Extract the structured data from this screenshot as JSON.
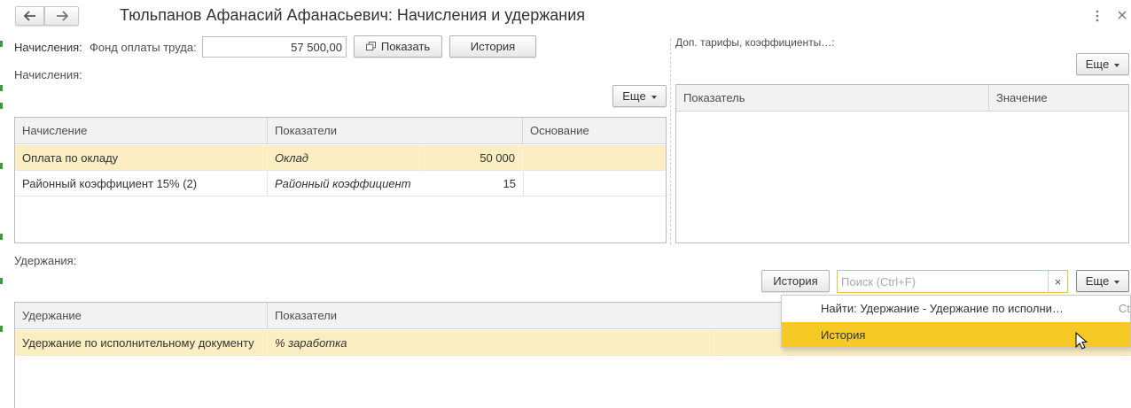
{
  "window": {
    "title": "Тюльпанов Афанасий Афанасьевич: Начисления и удержания",
    "more_icon": "more-vertical-icon",
    "close_icon": "close-icon",
    "back_icon": "arrow-left-icon",
    "forward_icon": "arrow-right-icon"
  },
  "accruals_bar": {
    "label": "Начисления:",
    "fund_label": "Фонд оплаты труда:",
    "fund_value": "57 500,00",
    "show_button": "Показать",
    "history_button": "История"
  },
  "accruals_section": {
    "label": "Начисления:",
    "more_button": "Еще",
    "columns": [
      "Начисление",
      "Показатели",
      "Основание"
    ],
    "rows": [
      {
        "name": "Оплата по окладу",
        "indicator": "Оклад",
        "value": "50 000",
        "basis": "",
        "selected": true
      },
      {
        "name": "Районный коэффициент 15% (2)",
        "indicator": "Районный коэффициент",
        "value": "15",
        "basis": "",
        "selected": false
      }
    ]
  },
  "tariffs_section": {
    "label": "Доп. тарифы, коэффициенты…:",
    "more_button": "Еще",
    "columns": [
      "Показатель",
      "Значение"
    ]
  },
  "deductions_section": {
    "label": "Удержания:",
    "history_button": "История",
    "search_placeholder": "Поиск (Ctrl+F)",
    "clear_label": "×",
    "more_button": "Еще",
    "columns": [
      "Удержание",
      "Показатели"
    ],
    "rows": [
      {
        "name": "Удержание по исполнительному документу",
        "indicator": "% заработка",
        "selected": true
      }
    ]
  },
  "dropdown_menu": {
    "items": [
      {
        "label": "Найти: Удержание - Удержание по исполни…",
        "shortcut": "Ctr"
      },
      {
        "label": "История",
        "shortcut": ""
      }
    ]
  },
  "colors": {
    "selected_row": "#fbeec2",
    "menu_highlight": "#f7c925",
    "search_border": "#e6c34d"
  }
}
